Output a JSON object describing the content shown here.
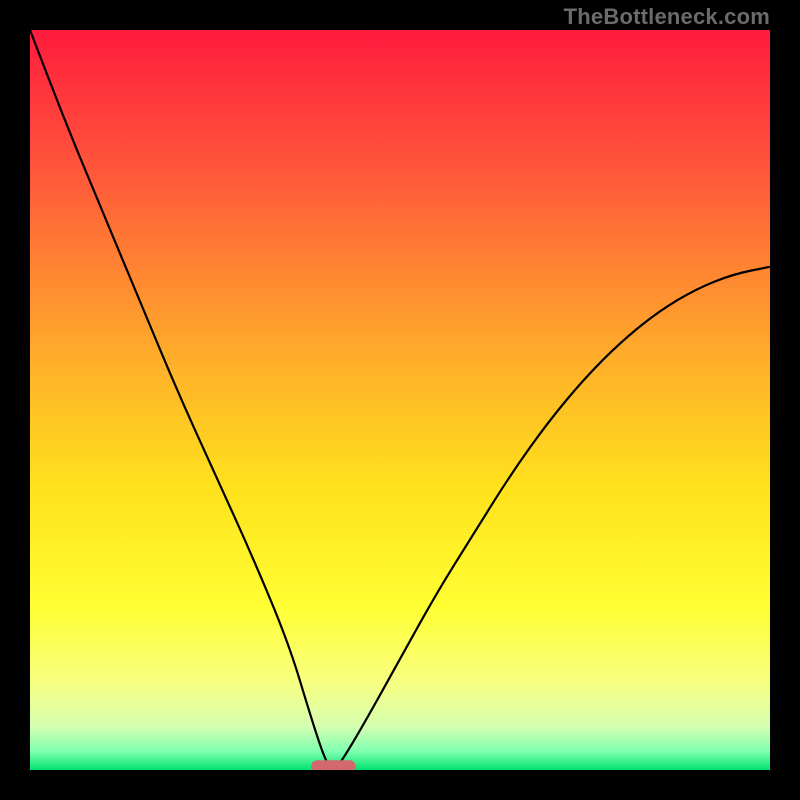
{
  "watermark": "TheBottleneck.com",
  "chart_data": {
    "type": "line",
    "title": "",
    "xlabel": "",
    "ylabel": "",
    "xlim": [
      0,
      100
    ],
    "ylim": [
      0,
      100
    ],
    "x": [
      0,
      5,
      10,
      15,
      20,
      25,
      30,
      35,
      38,
      40,
      41,
      42,
      45,
      50,
      55,
      60,
      65,
      70,
      75,
      80,
      85,
      90,
      95,
      100
    ],
    "series": [
      {
        "name": "bottleneck-curve",
        "values": [
          100,
          87,
          75,
          63,
          51,
          40,
          29,
          17,
          7,
          1,
          0,
          1,
          6,
          15,
          24,
          32,
          40,
          47,
          53,
          58,
          62,
          65,
          67,
          68
        ]
      }
    ],
    "marker": {
      "x_center": 41,
      "width": 6,
      "y": 0.5,
      "color": "#d1696d"
    },
    "gradient_stops": [
      {
        "offset": 0.0,
        "color": "#ff1b3d"
      },
      {
        "offset": 0.2,
        "color": "#ff5a3a"
      },
      {
        "offset": 0.45,
        "color": "#ffb02a"
      },
      {
        "offset": 0.62,
        "color": "#ffe21c"
      },
      {
        "offset": 0.78,
        "color": "#ffff33"
      },
      {
        "offset": 0.88,
        "color": "#f7ff80"
      },
      {
        "offset": 0.94,
        "color": "#d6ffb0"
      },
      {
        "offset": 0.975,
        "color": "#7fffb0"
      },
      {
        "offset": 1.0,
        "color": "#00e371"
      }
    ]
  }
}
